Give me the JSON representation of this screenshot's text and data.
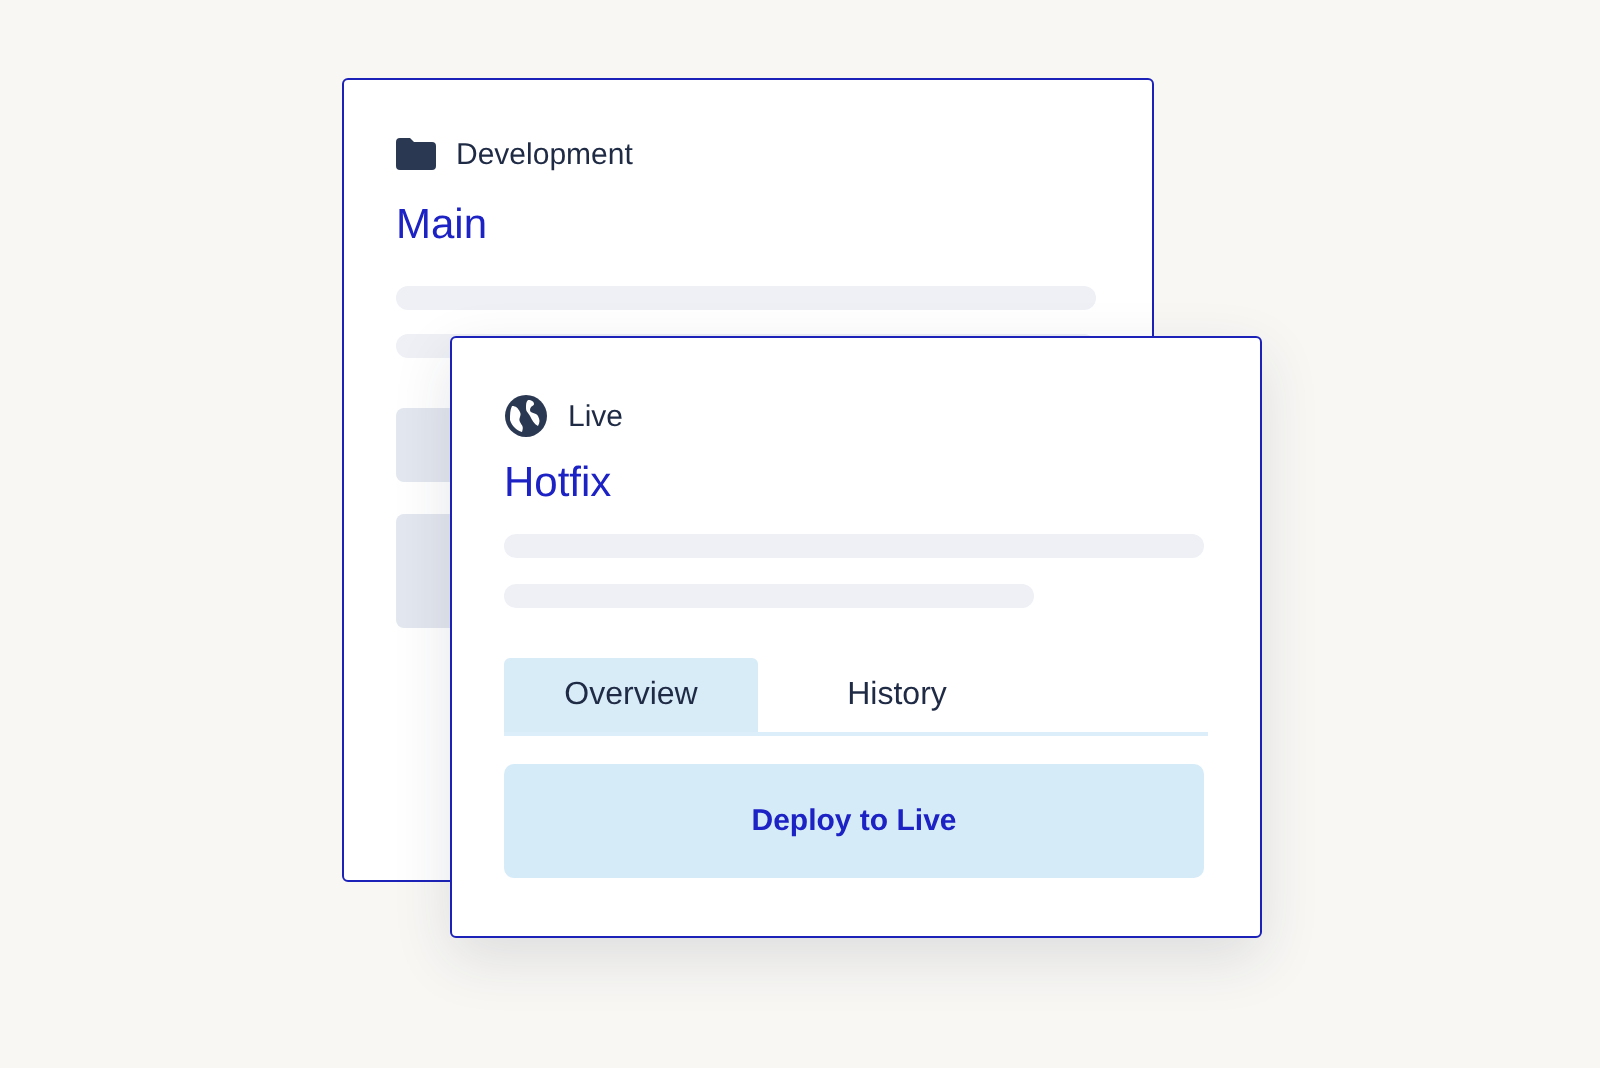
{
  "back_card": {
    "label": "Development",
    "title": "Main"
  },
  "front_card": {
    "label": "Live",
    "title": "Hotfix",
    "tabs": [
      {
        "label": "Overview",
        "selected": true
      },
      {
        "label": "History",
        "selected": false
      }
    ],
    "button": "Deploy to Live"
  }
}
